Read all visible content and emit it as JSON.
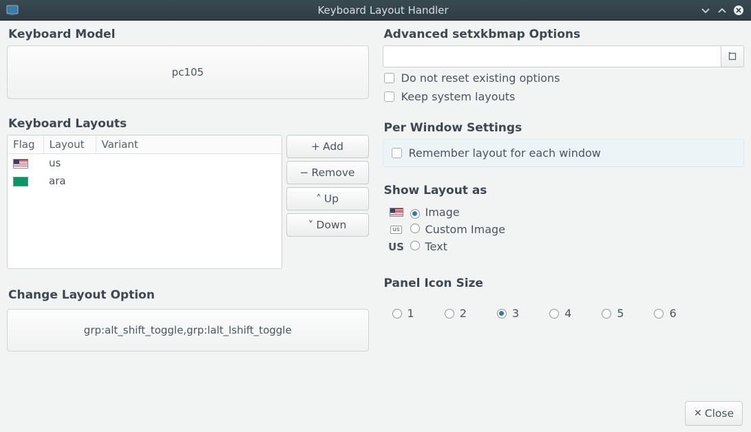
{
  "window": {
    "title": "Keyboard Layout Handler",
    "close_label": "Close"
  },
  "left": {
    "model_title": "Keyboard Model",
    "model_value": "pc105",
    "layouts_title": "Keyboard Layouts",
    "headers": {
      "flag": "Flag",
      "layout": "Layout",
      "variant": "Variant"
    },
    "rows": [
      {
        "flag": "us",
        "layout": "us",
        "variant": ""
      },
      {
        "flag": "ara",
        "layout": "ara",
        "variant": ""
      }
    ],
    "buttons": {
      "add": "Add",
      "remove": "Remove",
      "up": "Up",
      "down": "Down"
    },
    "change_title": "Change Layout Option",
    "change_value": "grp:alt_shift_toggle,grp:lalt_lshift_toggle"
  },
  "right": {
    "adv_title": "Advanced setxkbmap Options",
    "adv_value": "",
    "no_reset": "Do not reset existing options",
    "keep_sys": "Keep system layouts",
    "perwin_title": "Per Window Settings",
    "remember": "Remember layout for each window",
    "showas_title": "Show Layout as",
    "showas": {
      "image": "Image",
      "custom": "Custom Image",
      "text": "Text",
      "selected": "image",
      "text_abbrev": "US"
    },
    "panel_title": "Panel Icon Size",
    "panel_sizes": [
      "1",
      "2",
      "3",
      "4",
      "5",
      "6"
    ],
    "panel_selected": "3"
  }
}
